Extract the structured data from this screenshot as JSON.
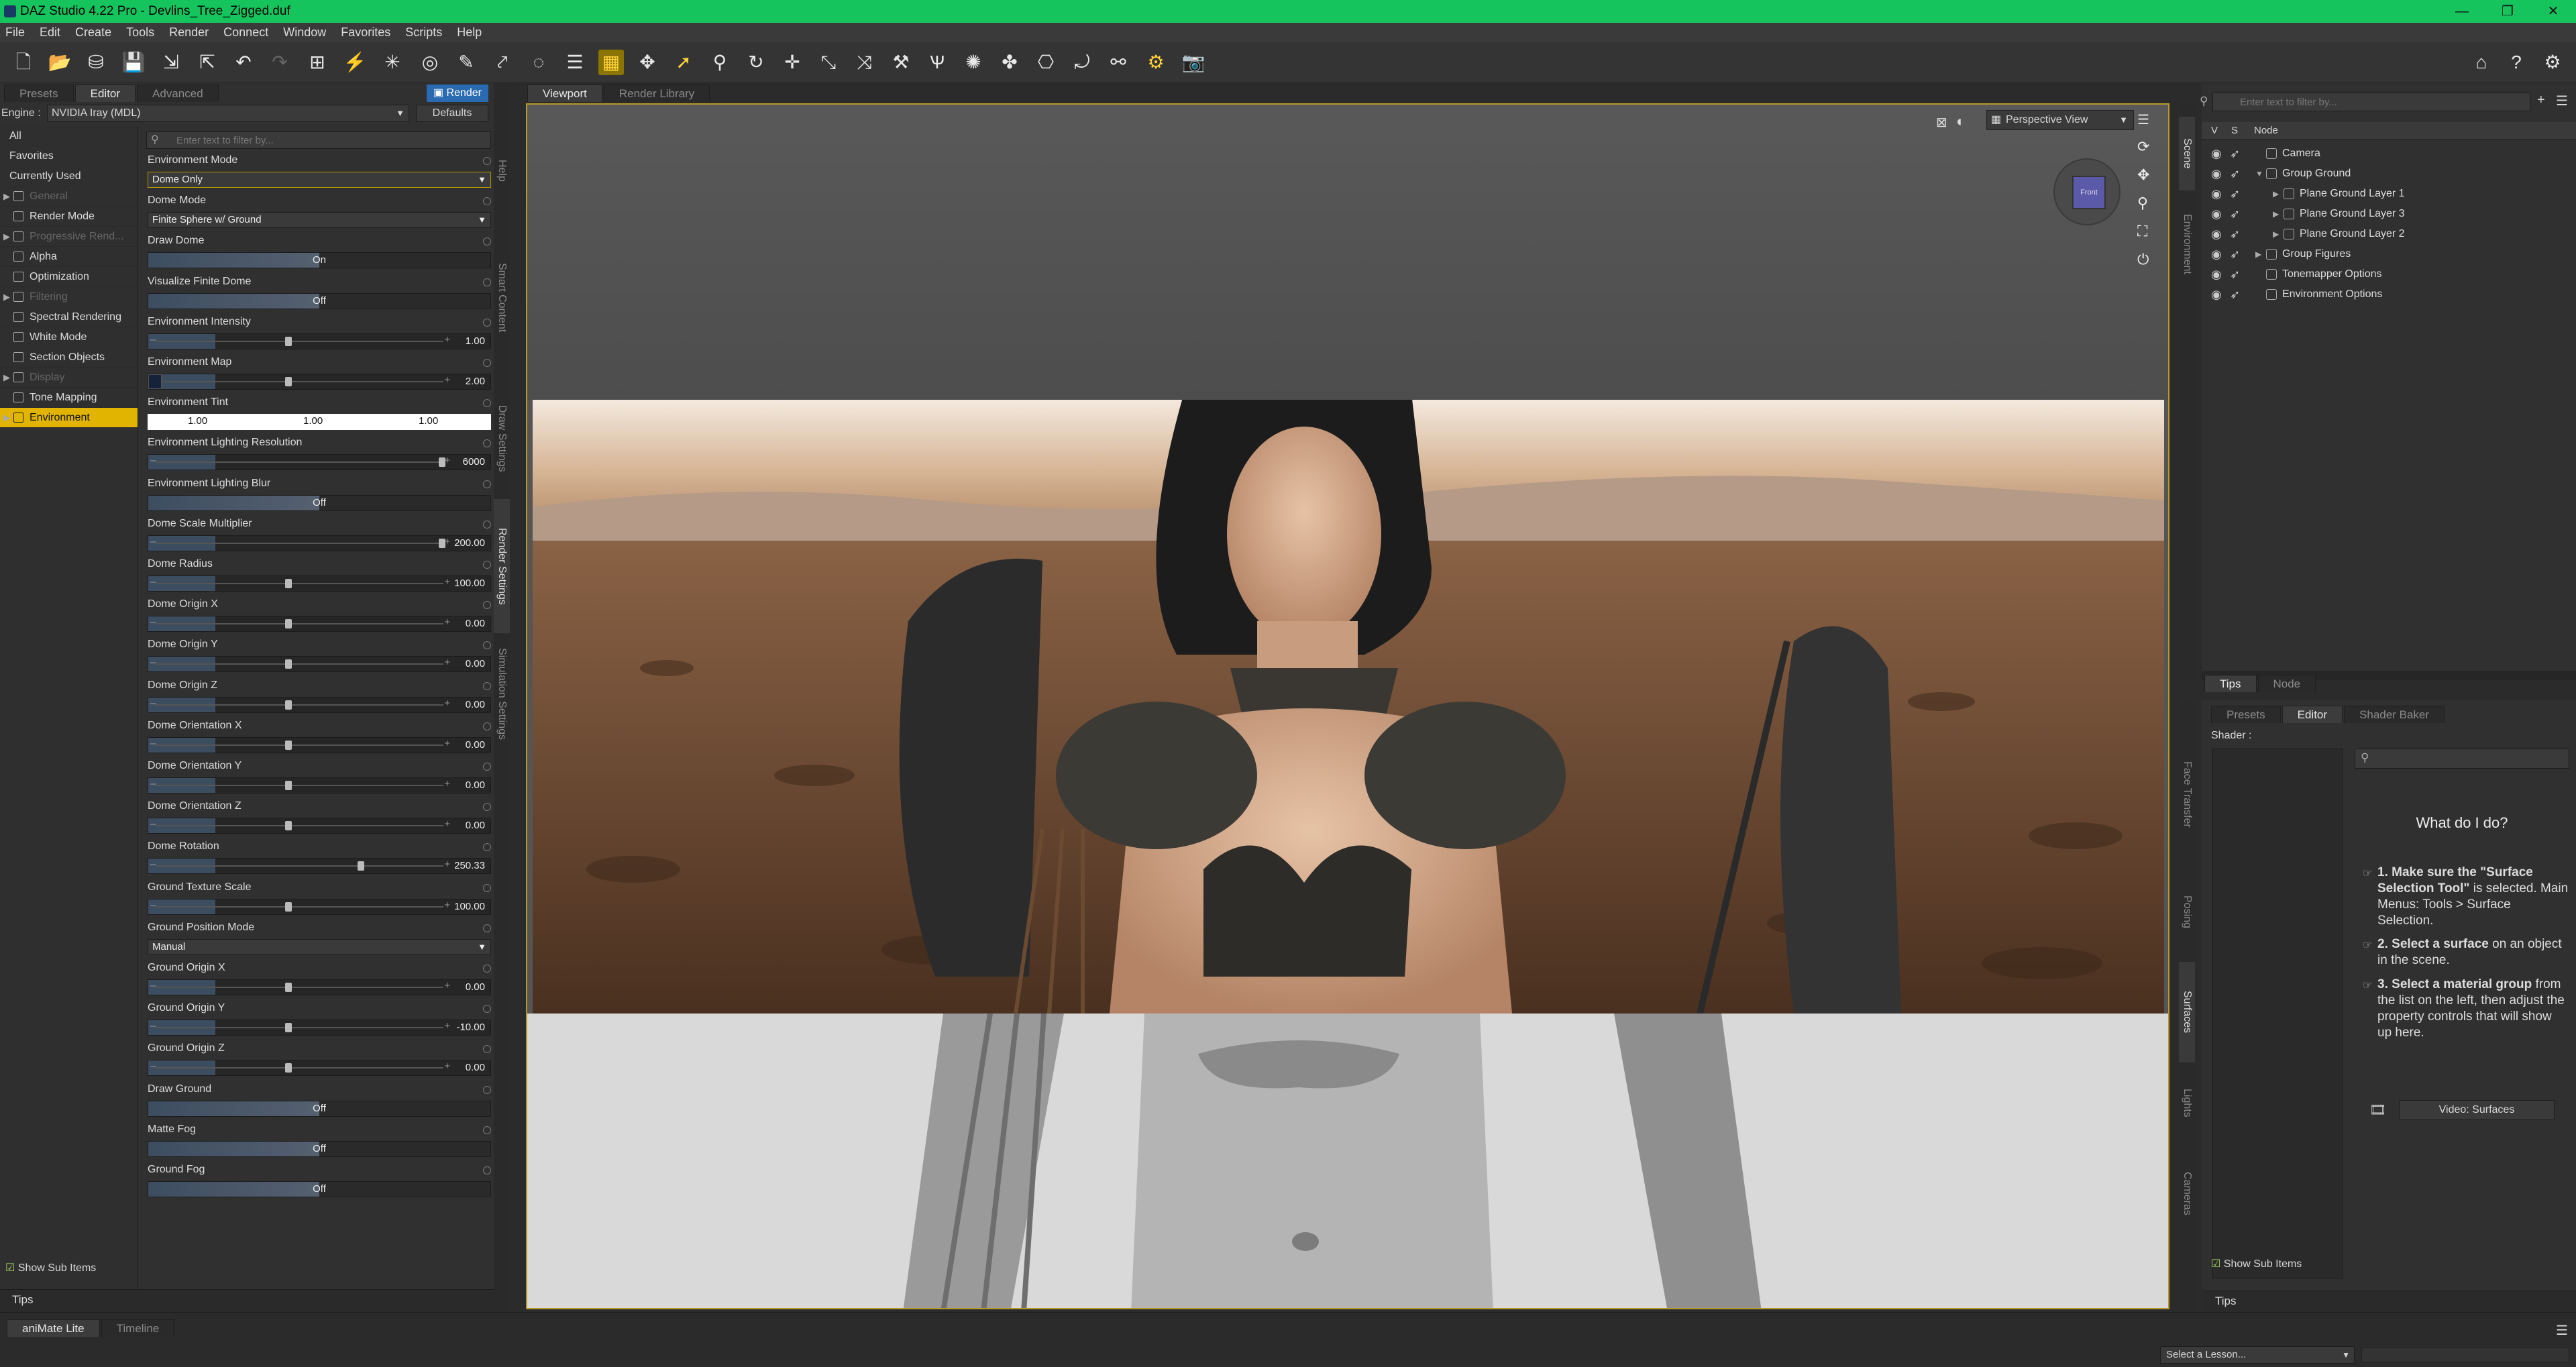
{
  "window": {
    "title": "DAZ Studio 4.22 Pro - Devlins_Tree_Zigged.duf",
    "controls": [
      "—",
      "❐",
      "✕"
    ]
  },
  "menu": [
    "File",
    "Edit",
    "Create",
    "Tools",
    "Render",
    "Connect",
    "Window",
    "Favorites",
    "Scripts",
    "Help"
  ],
  "left_panel": {
    "tabs": [
      "Presets",
      "Editor",
      "Advanced"
    ],
    "render_button": "Render",
    "engine_label": "Engine :",
    "engine_value": "NVIDIA Iray (MDL)",
    "defaults_button": "Defaults",
    "filter_placeholder": "Enter text to filter by...",
    "categories": [
      {
        "label": "All",
        "type": "plain"
      },
      {
        "label": "Favorites",
        "type": "plain"
      },
      {
        "label": "Currently Used",
        "type": "plain"
      },
      {
        "label": "General",
        "type": "dim",
        "expander": true
      },
      {
        "label": "Render Mode",
        "type": "normal"
      },
      {
        "label": "Progressive Rend...",
        "type": "dim",
        "expander": true
      },
      {
        "label": "Alpha",
        "type": "normal"
      },
      {
        "label": "Optimization",
        "type": "normal"
      },
      {
        "label": "Filtering",
        "type": "dim",
        "expander": true
      },
      {
        "label": "Spectral Rendering",
        "type": "normal"
      },
      {
        "label": "White Mode",
        "type": "normal"
      },
      {
        "label": "Section Objects",
        "type": "normal"
      },
      {
        "label": "Display",
        "type": "dim",
        "expander": true
      },
      {
        "label": "Tone Mapping",
        "type": "normal"
      },
      {
        "label": "Environment",
        "type": "selected",
        "expander": true
      }
    ],
    "properties": [
      {
        "label": "Environment Mode",
        "kind": "dropdown",
        "value": "Dome Only",
        "highlight": true
      },
      {
        "label": "Dome Mode",
        "kind": "dropdown",
        "value": "Finite Sphere w/ Ground"
      },
      {
        "label": "Draw Dome",
        "kind": "toggle",
        "value": "On"
      },
      {
        "label": "Visualize Finite Dome",
        "kind": "toggle",
        "value": "Off"
      },
      {
        "label": "Environment Intensity",
        "kind": "slider",
        "value": "1.00",
        "pos": 0.45
      },
      {
        "label": "Environment Map",
        "kind": "slider",
        "value": "2.00",
        "pos": 0.45,
        "swatch": true
      },
      {
        "label": "Environment Tint",
        "kind": "tint",
        "values": [
          "1.00",
          "1.00",
          "1.00"
        ]
      },
      {
        "label": "Environment Lighting Resolution",
        "kind": "slider",
        "value": "6000",
        "pos": 0.98
      },
      {
        "label": "Environment Lighting Blur",
        "kind": "toggle",
        "value": "Off"
      },
      {
        "label": "Dome Scale Multiplier",
        "kind": "slider",
        "value": "200.00",
        "pos": 0.98
      },
      {
        "label": "Dome Radius",
        "kind": "slider",
        "value": "100.00",
        "pos": 0.45
      },
      {
        "label": "Dome Origin X",
        "kind": "slider",
        "value": "0.00",
        "pos": 0.45
      },
      {
        "label": "Dome Origin Y",
        "kind": "slider",
        "value": "0.00",
        "pos": 0.45
      },
      {
        "label": "Dome Origin Z",
        "kind": "slider",
        "value": "0.00",
        "pos": 0.45
      },
      {
        "label": "Dome Orientation X",
        "kind": "slider",
        "value": "0.00",
        "pos": 0.45
      },
      {
        "label": "Dome Orientation Y",
        "kind": "slider",
        "value": "0.00",
        "pos": 0.45
      },
      {
        "label": "Dome Orientation Z",
        "kind": "slider",
        "value": "0.00",
        "pos": 0.45
      },
      {
        "label": "Dome Rotation",
        "kind": "slider",
        "value": "250.33",
        "pos": 0.7
      },
      {
        "label": "Ground Texture Scale",
        "kind": "slider",
        "value": "100.00",
        "pos": 0.45
      },
      {
        "label": "Ground Position Mode",
        "kind": "dropdown",
        "value": "Manual"
      },
      {
        "label": "Ground Origin X",
        "kind": "slider",
        "value": "0.00",
        "pos": 0.45
      },
      {
        "label": "Ground Origin Y",
        "kind": "slider",
        "value": "-10.00",
        "pos": 0.45
      },
      {
        "label": "Ground Origin Z",
        "kind": "slider",
        "value": "0.00",
        "pos": 0.45
      },
      {
        "label": "Draw Ground",
        "kind": "toggle",
        "value": "Off"
      },
      {
        "label": "Matte Fog",
        "kind": "toggle",
        "value": "Off"
      },
      {
        "label": "Ground Fog",
        "kind": "toggle",
        "value": "Off"
      }
    ],
    "show_sub_items": "Show Sub Items",
    "tips_tab": "Tips",
    "side_tabs": [
      "Help",
      "Smart Content",
      "Draw Settings",
      "Render Settings",
      "Simulation Settings"
    ]
  },
  "viewport": {
    "tabs": [
      "Viewport",
      "Render Library"
    ],
    "view_selector": "Perspective View",
    "nav_cube_label": "Front"
  },
  "scene": {
    "side_tabs": [
      "Scene",
      "Environment"
    ],
    "filter_placeholder": "Enter text to filter by...",
    "columns": [
      "V",
      "S",
      "Node"
    ],
    "nodes": [
      {
        "label": "Camera",
        "depth": 0,
        "expander": false
      },
      {
        "label": "Group Ground",
        "depth": 0,
        "expander": true,
        "open": true
      },
      {
        "label": "Plane Ground Layer 1",
        "depth": 1,
        "expander": true
      },
      {
        "label": "Plane Ground Layer 3",
        "depth": 1,
        "expander": true
      },
      {
        "label": "Plane Ground Layer 2",
        "depth": 1,
        "expander": true
      },
      {
        "label": "Group Figures",
        "depth": 0,
        "expander": true
      },
      {
        "label": "Tonemapper Options",
        "depth": 0,
        "expander": false
      },
      {
        "label": "Environment Options",
        "depth": 0,
        "expander": false
      }
    ],
    "bottom_tabs": [
      "Tips",
      "Node"
    ]
  },
  "surfaces": {
    "tabs": [
      "Presets",
      "Editor",
      "Shader Baker"
    ],
    "shader_label": "Shader :",
    "side_tabs": [
      "Face Transfer",
      "Posing",
      "Surfaces",
      "Lights",
      "Cameras"
    ],
    "heading": "What do I do?",
    "steps": [
      {
        "num": "1.",
        "bold": "Make sure the \"Surface Selection Tool\"",
        "rest": " is selected. Main Menus: Tools > Surface Selection."
      },
      {
        "num": "2.",
        "bold": "Select a surface",
        "rest": " on an object in the scene."
      },
      {
        "num": "3.",
        "bold": "Select a material group",
        "rest": " from the list on the left, then adjust the property controls that will show up here."
      }
    ],
    "video_button": "Video: Surfaces",
    "show_sub_items": "Show Sub Items",
    "tips_tab": "Tips"
  },
  "bottom": {
    "tabs": [
      "aniMate Lite",
      "Timeline"
    ],
    "lesson_select": "Select a Lesson..."
  }
}
